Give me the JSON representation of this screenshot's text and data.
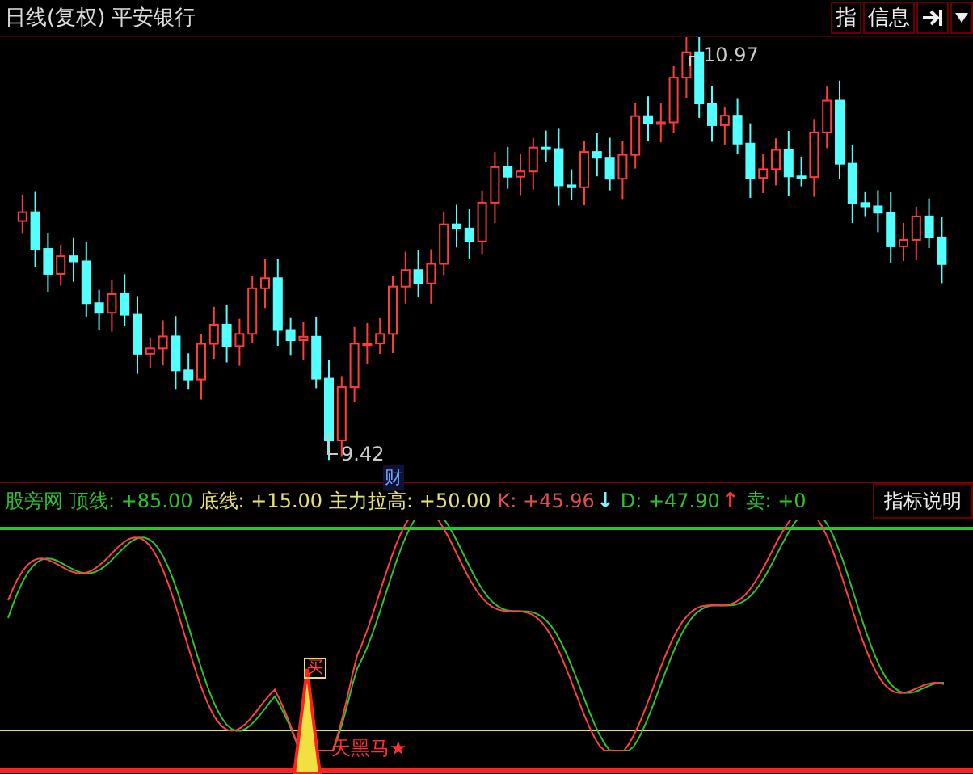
{
  "header": {
    "period": "日线(复权)",
    "stock": "平安银行"
  },
  "toolbar": [
    {
      "kind": "text",
      "label": "指"
    },
    {
      "kind": "text",
      "label": "信息"
    },
    {
      "kind": "exit"
    },
    {
      "kind": "dropdown"
    }
  ],
  "price_chart": {
    "high_label": "10.97",
    "low_label": "9.42",
    "event_badge": "财"
  },
  "legend": {
    "name": "股旁网",
    "items": [
      {
        "label": "顶线:",
        "value": "+85.00",
        "color": "#30c030"
      },
      {
        "label": "底线:",
        "value": "+15.00",
        "color": "#e8e070"
      },
      {
        "label": "主力拉高:",
        "value": "+50.00",
        "color": "#e8e070"
      },
      {
        "label": "K:",
        "value": "+45.96",
        "color": "#e05050",
        "arrow": "↓"
      },
      {
        "label": "D:",
        "value": "+47.90",
        "color": "#30c030",
        "arrow": "↑"
      },
      {
        "label": "卖:",
        "value": "+0",
        "color": "#30c030"
      }
    ],
    "button": "指标说明"
  },
  "indicator_chart": {
    "signal_label": "买",
    "marker_label": "天黑马★"
  }
}
